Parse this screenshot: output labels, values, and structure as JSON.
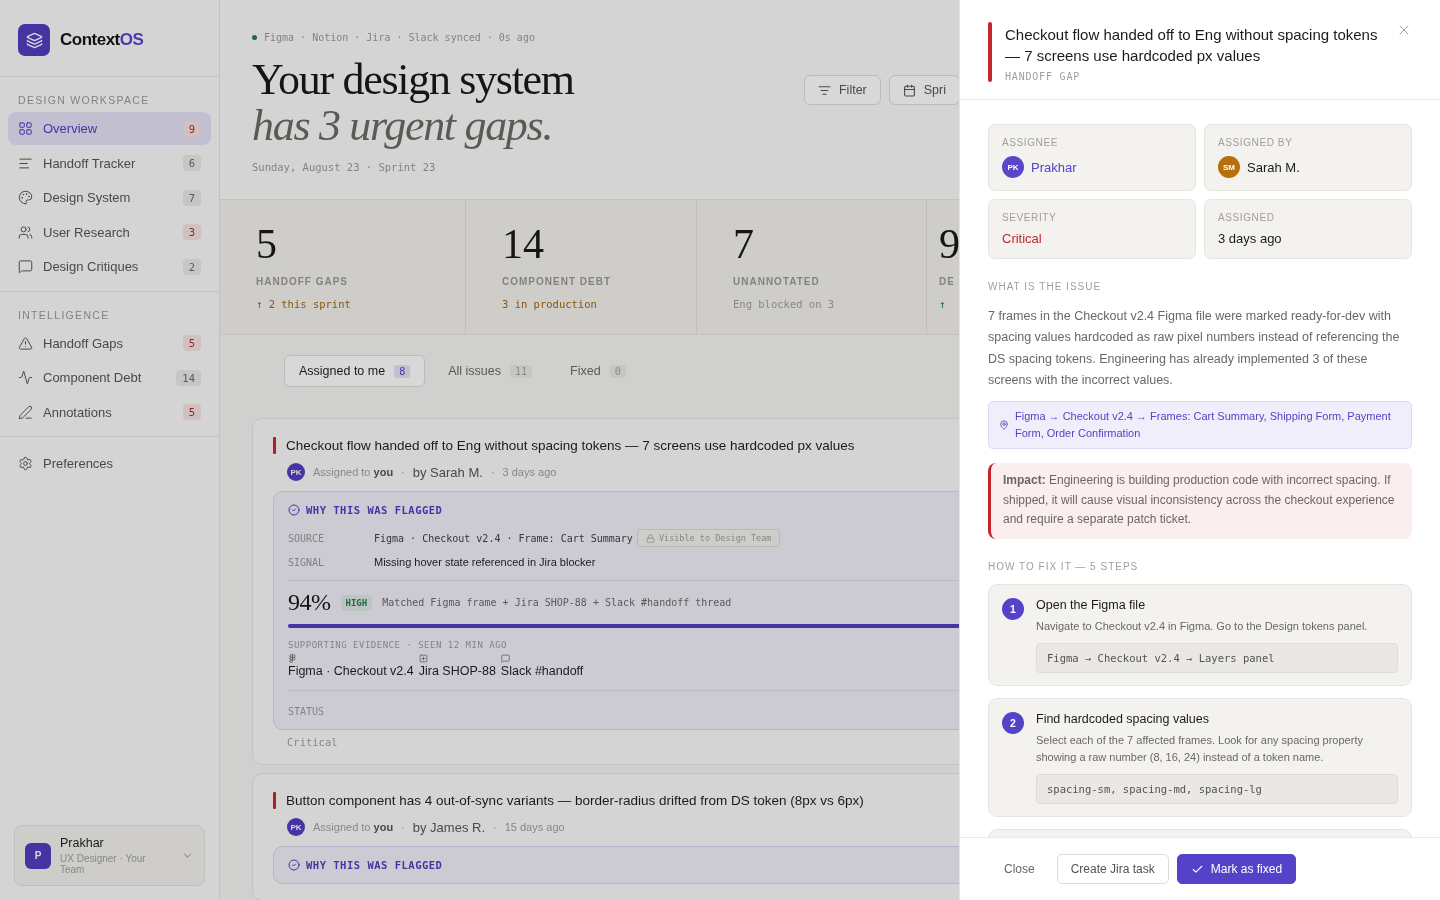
{
  "brand": {
    "name_main": "Context",
    "name_accent": "OS"
  },
  "sidebar": {
    "sections": [
      {
        "label": "DESIGN WORKSPACE",
        "items": [
          {
            "label": "Overview",
            "count": "9",
            "urgent": true,
            "selected": true
          },
          {
            "label": "Handoff Tracker",
            "count": "6",
            "urgent": false,
            "selected": false
          },
          {
            "label": "Design System",
            "count": "7",
            "urgent": false,
            "selected": false
          },
          {
            "label": "User Research",
            "count": "3",
            "urgent": true,
            "selected": false
          },
          {
            "label": "Design Critiques",
            "count": "2",
            "urgent": false,
            "selected": false
          }
        ]
      },
      {
        "label": "INTELLIGENCE",
        "items": [
          {
            "label": "Handoff Gaps",
            "count": "5",
            "urgent": true,
            "selected": false
          },
          {
            "label": "Component Debt",
            "count": "14",
            "urgent": false,
            "selected": false
          },
          {
            "label": "Annotations",
            "count": "5",
            "urgent": true,
            "selected": false
          }
        ]
      }
    ],
    "preferences": "Preferences",
    "user": {
      "initial": "P",
      "name": "Prakhar",
      "role": "UX Designer · Your Team"
    }
  },
  "header": {
    "sync": "Figma · Notion · Jira · Slack synced · 0s ago",
    "title": "Your design system",
    "subtitle": "has 3 urgent gaps.",
    "date": "Sunday, August 23 · Sprint 23",
    "buttons": [
      {
        "label": "Filter",
        "kind": "filter"
      },
      {
        "label": "Spri",
        "kind": "calendar"
      }
    ]
  },
  "stats": [
    {
      "value": "5",
      "label": "HANDOFF GAPS",
      "note": "↑ 2 this sprint",
      "kind": "warn"
    },
    {
      "value": "14",
      "label": "COMPONENT DEBT",
      "note": "3 in production",
      "kind": "warn"
    },
    {
      "value": "7",
      "label": "UNANNOTATED",
      "note": "Eng blocked on 3",
      "kind": "muted"
    },
    {
      "value": "9",
      "label": "DE",
      "note": "↑",
      "kind": "up"
    }
  ],
  "tabs": [
    {
      "label": "Assigned to me",
      "count": "8",
      "selected": true
    },
    {
      "label": "All issues",
      "count": "11",
      "selected": false
    },
    {
      "label": "Fixed",
      "count": "0",
      "selected": false
    }
  ],
  "issues": [
    {
      "title": "Checkout flow handed off to Eng without spacing tokens — 7 screens use hardcoded px values",
      "initials": "PK",
      "assigned": "Assigned to **you**",
      "separators": [
        "·",
        "·"
      ],
      "by": "by Sarah M.",
      "age": "3 days ago",
      "flag": {
        "heading": "WHY THIS WAS FLAGGED",
        "source_label": "SOURCE",
        "source": "Figma · Checkout v2.4 · Frame: Cart Summary",
        "visibility": "Visible to Design Team",
        "signal_label": "SIGNAL",
        "signal": "Missing hover state referenced in Jira blocker",
        "confidence": "94%",
        "confidence_tag": "HIGH",
        "match": "Matched Figma frame + Jira SHOP-88 + Slack #handoff thread",
        "level": 0.94,
        "evidence_heading": "SUPPORTING EVIDENCE · SEEN 12 MIN AGO",
        "evidence": [
          {
            "label": "Figma · Checkout v2.4",
            "kind": "figma"
          },
          {
            "label": "Jira SHOP-88",
            "kind": "jira"
          },
          {
            "label": "Slack #handoff",
            "kind": "slack"
          }
        ],
        "status_label": "STATUS"
      },
      "status": "Critical"
    },
    {
      "title": "Button component has 4 out-of-sync variants — border-radius drifted from DS token (8px vs 6px)",
      "initials": "PK",
      "assigned": "Assigned to **you**",
      "separators": [
        "·",
        "·"
      ],
      "by": "by James R.",
      "age": "15 days ago",
      "flag": {
        "heading": "WHY THIS WAS FLAGGED"
      }
    }
  ],
  "drawer": {
    "title": "Checkout flow handed off to Eng without spacing tokens — 7 screens use hardcoded px values",
    "category": "HANDOFF GAP",
    "fields": [
      {
        "label": "ASSIGNEE",
        "value": "Prakhar",
        "initials": "PK",
        "kind": "person",
        "color": "#5b45c9"
      },
      {
        "label": "ASSIGNED BY",
        "value": "Sarah M.",
        "initials": "SM",
        "kind": "person",
        "color": "#b86e0a"
      },
      {
        "label": "SEVERITY",
        "value": "Critical",
        "kind": "severity"
      },
      {
        "label": "ASSIGNED",
        "value": "3 days ago",
        "kind": "text"
      }
    ],
    "issue_heading": "WHAT IS THE ISSUE",
    "issue": "7 frames in the Checkout v2.4 Figma file were marked ready-for-dev with spacing values hardcoded as raw pixel numbers instead of referencing the DS spacing tokens. Engineering has already implemented 3 of these screens with the incorrect values.",
    "path": "Figma → Checkout v2.4 → Frames: Cart Summary, Shipping Form, Payment Form, Order Confirmation",
    "impact": "**Impact:** Engineering is building production code with incorrect spacing. If shipped, it will cause visual inconsistency across the checkout experience and require a separate patch ticket.",
    "steps_heading": "HOW TO FIX IT — 5 STEPS",
    "steps": [
      {
        "number": "1",
        "title": "Open the Figma file",
        "text": "Navigate to Checkout v2.4 in Figma. Go to the Design tokens panel.",
        "code": "Figma → Checkout v2.4 → Layers panel"
      },
      {
        "number": "2",
        "title": "Find hardcoded spacing values",
        "text": "Select each of the 7 affected frames. Look for any spacing property showing a raw number (8, 16, 24) instead of a token name.",
        "code": "spacing-sm, spacing-md, spacing-lg"
      }
    ],
    "footer": {
      "close": "Close",
      "secondary": "Create Jira task",
      "primary": "Mark as fixed"
    }
  }
}
